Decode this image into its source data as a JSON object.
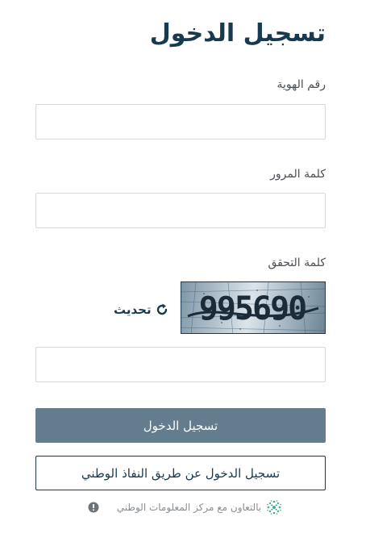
{
  "title": "تسجيل الدخول",
  "id_field": {
    "label": "رقم الهوية",
    "value": "",
    "placeholder": ""
  },
  "password_field": {
    "label": "كلمة المرور",
    "value": "",
    "placeholder": ""
  },
  "captcha": {
    "label": "كلمة التحقق",
    "image_text": "995690",
    "refresh_label": "تحديث",
    "input_value": "",
    "input_placeholder": ""
  },
  "login_button": "تسجيل الدخول",
  "nafath_button": "تسجيل الدخول عن طريق النفاذ الوطني",
  "footer": {
    "text": "بالتعاون مع مركز المعلومات الوطني"
  },
  "icons": {
    "refresh": "refresh-icon",
    "nic_logo": "nic-logo-icon",
    "info": "info-icon"
  },
  "colors": {
    "brand_dark": "#183a4e",
    "primary_button": "#637c8e",
    "input_border": "#d6d9dc",
    "muted_text": "#8a8f94",
    "logo_green": "#3fae8a"
  }
}
